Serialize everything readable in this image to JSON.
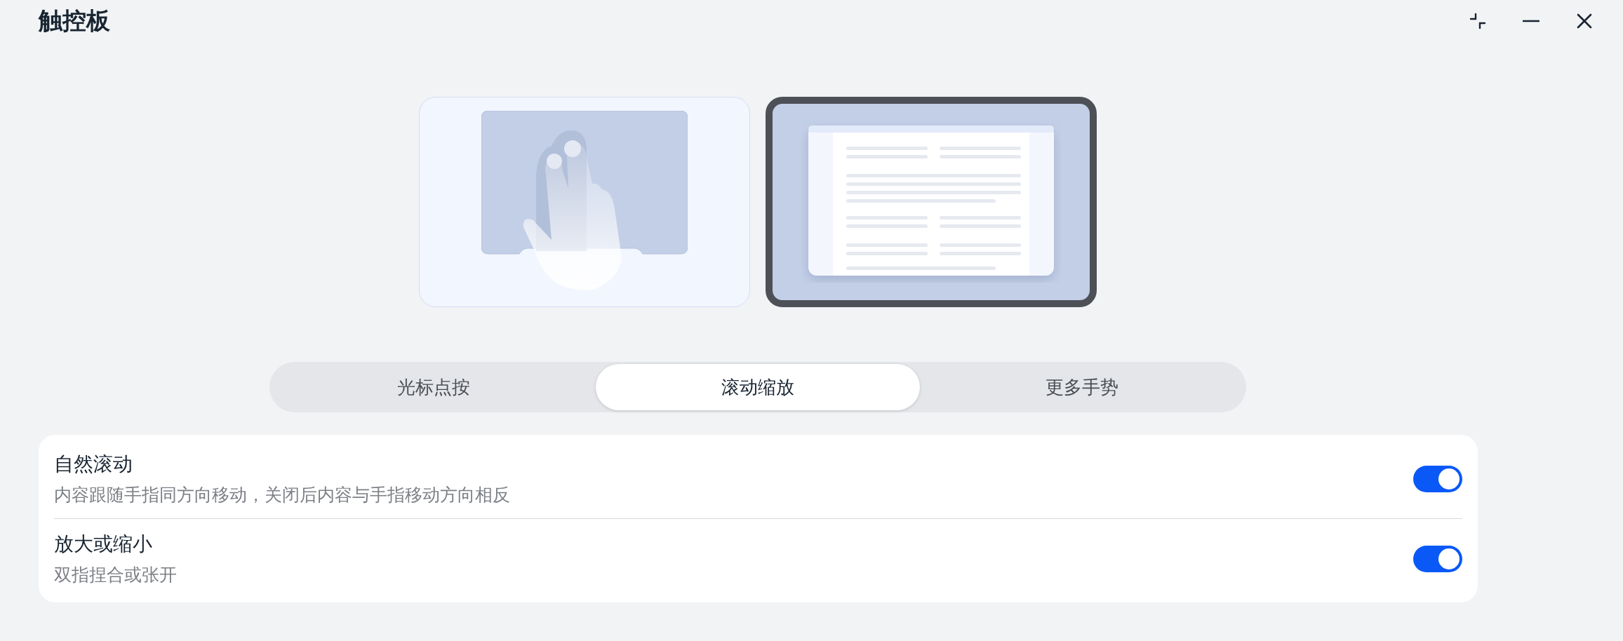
{
  "window": {
    "title": "触控板"
  },
  "previews": [
    {
      "kind": "gesture",
      "selected": false
    },
    {
      "kind": "document",
      "selected": true
    }
  ],
  "tabs": [
    {
      "label": "光标点按",
      "selected": false
    },
    {
      "label": "滚动缩放",
      "selected": true
    },
    {
      "label": "更多手势",
      "selected": false
    }
  ],
  "settings": [
    {
      "title": "自然滚动",
      "description": "内容跟随手指同方向移动，关闭后内容与手指移动方向相反",
      "on": true
    },
    {
      "title": "放大或缩小",
      "description": "双指捏合或张开",
      "on": true
    }
  ]
}
